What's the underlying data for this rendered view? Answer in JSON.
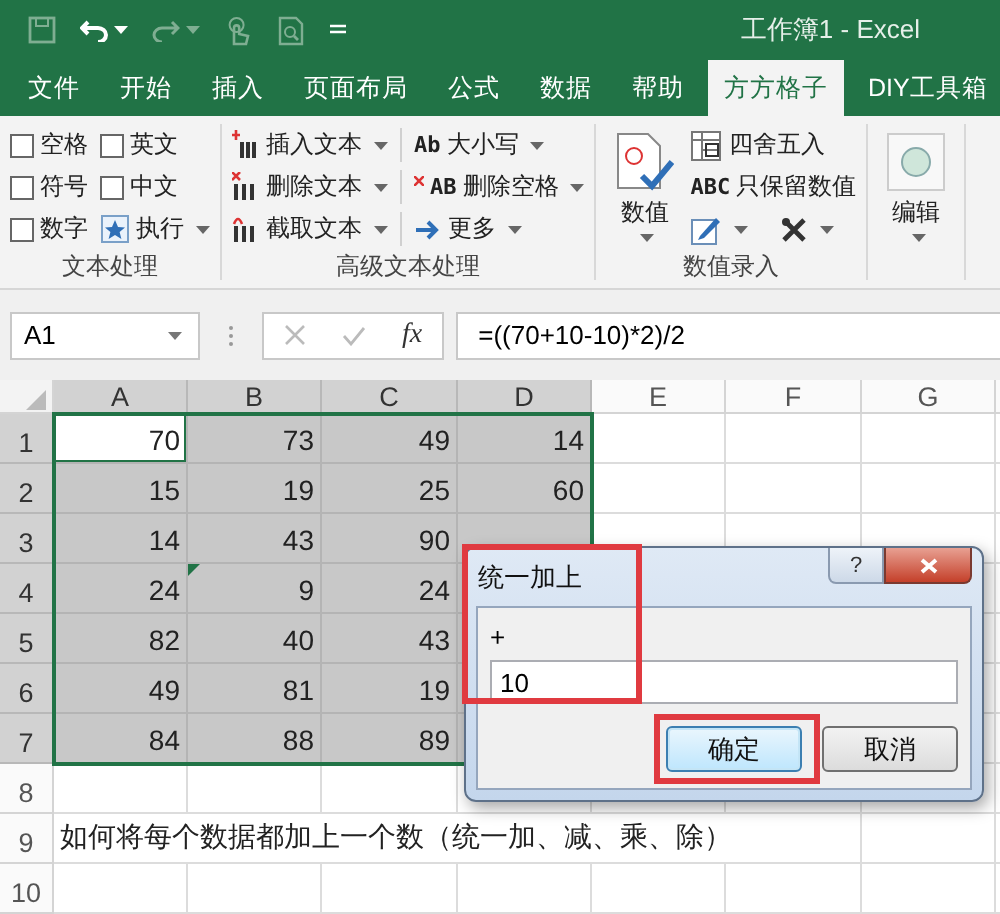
{
  "title_bar": {
    "title": "工作簿1 - Excel"
  },
  "tabs": [
    {
      "label": "文件",
      "selected": false
    },
    {
      "label": "开始",
      "selected": false
    },
    {
      "label": "插入",
      "selected": false
    },
    {
      "label": "页面布局",
      "selected": false
    },
    {
      "label": "公式",
      "selected": false
    },
    {
      "label": "数据",
      "selected": false
    },
    {
      "label": "帮助",
      "selected": false
    },
    {
      "label": "方方格子",
      "selected": true
    },
    {
      "label": "DIY工具箱",
      "selected": false
    }
  ],
  "ribbon": {
    "groups": [
      {
        "label": "文本处理",
        "items": [
          {
            "kind": "checkbox",
            "label": "空格",
            "checked": false
          },
          {
            "kind": "checkbox",
            "label": "英文",
            "checked": false
          },
          {
            "kind": "checkbox",
            "label": "符号",
            "checked": false
          },
          {
            "kind": "checkbox",
            "label": "中文",
            "checked": false
          },
          {
            "kind": "checkbox",
            "label": "数字",
            "checked": false
          },
          {
            "kind": "dropdown",
            "label": "执行"
          }
        ]
      },
      {
        "label": "高级文本处理",
        "items": [
          {
            "kind": "dropdown",
            "label": "插入文本"
          },
          {
            "kind": "dropdown",
            "label": "删除文本"
          },
          {
            "kind": "dropdown",
            "label": "截取文本"
          },
          {
            "kind": "dropdown",
            "label": "大小写",
            "icon_text": "Ab"
          },
          {
            "kind": "dropdown",
            "label": "删除空格",
            "icon_text": "AB"
          },
          {
            "kind": "dropdown",
            "label": "更多"
          }
        ]
      },
      {
        "label": "数值录入",
        "items": [
          {
            "kind": "large",
            "label": "数值"
          },
          {
            "kind": "button",
            "label": "四舍五入"
          },
          {
            "kind": "button",
            "label": "只保留数值",
            "icon_text": "ABC"
          },
          {
            "kind": "icon_dropdown"
          },
          {
            "kind": "icon_dropdown"
          }
        ]
      },
      {
        "items": [
          {
            "kind": "large",
            "label": "编辑"
          }
        ]
      }
    ]
  },
  "formula_bar": {
    "name_box": "A1",
    "function_label": "fx",
    "formula": "=((70+10-10)*2)/2"
  },
  "sheet": {
    "columns": [
      {
        "label": "A",
        "selected": true
      },
      {
        "label": "B",
        "selected": true
      },
      {
        "label": "C",
        "selected": true
      },
      {
        "label": "D",
        "selected": true
      },
      {
        "label": "E",
        "selected": false
      },
      {
        "label": "F",
        "selected": false
      },
      {
        "label": "G",
        "selected": false
      }
    ],
    "rows": [
      {
        "label": "1",
        "selected": true,
        "cells": [
          {
            "value": "70",
            "kind": "number",
            "selected": true,
            "active": true,
            "flag": false
          },
          {
            "value": "73",
            "kind": "number",
            "selected": true,
            "active": false,
            "flag": false
          },
          {
            "value": "49",
            "kind": "number",
            "selected": true,
            "active": false,
            "flag": false
          },
          {
            "value": "14",
            "kind": "number",
            "selected": true,
            "active": false,
            "flag": false
          }
        ]
      },
      {
        "label": "2",
        "selected": true,
        "cells": [
          {
            "value": "15",
            "kind": "number",
            "selected": true,
            "active": false,
            "flag": false
          },
          {
            "value": "19",
            "kind": "number",
            "selected": true,
            "active": false,
            "flag": false
          },
          {
            "value": "25",
            "kind": "number",
            "selected": true,
            "active": false,
            "flag": false
          },
          {
            "value": "60",
            "kind": "number",
            "selected": true,
            "active": false,
            "flag": false
          }
        ]
      },
      {
        "label": "3",
        "selected": true,
        "cells": [
          {
            "value": "14",
            "kind": "number",
            "selected": true,
            "active": false,
            "flag": false
          },
          {
            "value": "43",
            "kind": "number",
            "selected": true,
            "active": false,
            "flag": false
          },
          {
            "value": "90",
            "kind": "number",
            "selected": true,
            "active": false,
            "flag": false
          }
        ]
      },
      {
        "label": "4",
        "selected": true,
        "cells": [
          {
            "value": "24",
            "kind": "number",
            "selected": true,
            "active": false,
            "flag": false
          },
          {
            "value": "9",
            "kind": "number",
            "selected": true,
            "active": false,
            "flag": true
          },
          {
            "value": "24",
            "kind": "number",
            "selected": true,
            "active": false,
            "flag": false
          }
        ]
      },
      {
        "label": "5",
        "selected": true,
        "cells": [
          {
            "value": "82",
            "kind": "number",
            "selected": true,
            "active": false,
            "flag": false
          },
          {
            "value": "40",
            "kind": "number",
            "selected": true,
            "active": false,
            "flag": false
          },
          {
            "value": "43",
            "kind": "number",
            "selected": true,
            "active": false,
            "flag": false
          }
        ]
      },
      {
        "label": "6",
        "selected": true,
        "cells": [
          {
            "value": "49",
            "kind": "number",
            "selected": true,
            "active": false,
            "flag": false
          },
          {
            "value": "81",
            "kind": "number",
            "selected": true,
            "active": false,
            "flag": false
          },
          {
            "value": "19",
            "kind": "number",
            "selected": true,
            "active": false,
            "flag": false
          }
        ]
      },
      {
        "label": "7",
        "selected": true,
        "cells": [
          {
            "value": "84",
            "kind": "number",
            "selected": true,
            "active": false,
            "flag": false
          },
          {
            "value": "88",
            "kind": "number",
            "selected": true,
            "active": false,
            "flag": false
          },
          {
            "value": "89",
            "kind": "number",
            "selected": true,
            "active": false,
            "flag": false
          }
        ]
      },
      {
        "label": "8",
        "selected": false
      },
      {
        "label": "9",
        "selected": false,
        "cells": [
          {
            "value": "如何将每个数据都加上一个数（统一加、减、乘、除）",
            "kind": "text",
            "selected": false,
            "active": false,
            "flag": false
          }
        ]
      },
      {
        "label": "10",
        "selected": false
      }
    ]
  },
  "dialog": {
    "title": "统一加上",
    "help_label": "?",
    "field_label": "+",
    "value": "10",
    "buttons": [
      {
        "label": "确定",
        "default": true
      },
      {
        "label": "取消",
        "default": false
      }
    ]
  }
}
